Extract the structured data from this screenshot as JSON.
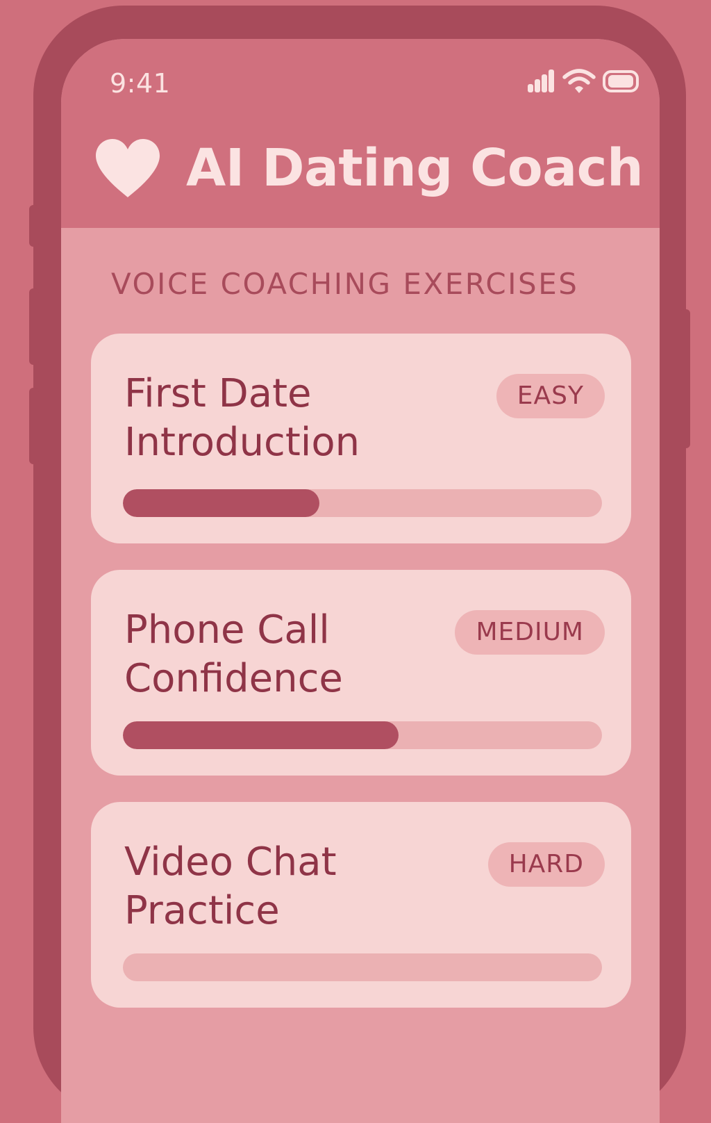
{
  "status_bar": {
    "time": "9:41",
    "signal_icon": "cellular-signal-icon",
    "wifi_icon": "wifi-icon",
    "battery_icon": "battery-icon"
  },
  "header": {
    "title": "AI Dating Coach",
    "logo_icon": "heart-icon"
  },
  "section": {
    "title": "VOICE COACHING EXERCISES"
  },
  "exercises": [
    {
      "title": "First Date Introduction",
      "difficulty": "EASY",
      "progress": 0.41
    },
    {
      "title": "Phone Call Confidence",
      "difficulty": "MEDIUM",
      "progress": 0.575
    },
    {
      "title": "Video Chat Practice",
      "difficulty": "HARD",
      "progress": 0
    }
  ],
  "colors": {
    "background": "#cf6f7c",
    "frame": "#a84b5b",
    "header": "#d0707e",
    "screen": "#e59da4",
    "card": "#f7d5d4",
    "accent": "#b04f61",
    "text_light": "#fbe3e2",
    "text_dark": "#8f3447"
  }
}
